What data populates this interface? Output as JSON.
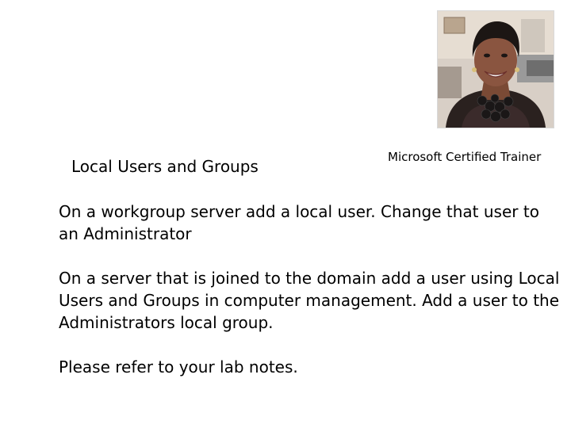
{
  "slide": {
    "title": "Local Users and Groups",
    "photo_caption": "Microsoft Certified Trainer",
    "paragraphs": [
      "On a workgroup server add a local user.  Change that user to an Administrator",
      "On a server that is joined to the domain add a user using Local Users and Groups in computer management.  Add a user to the Administrators local group.",
      "Please refer to your lab notes."
    ]
  },
  "colors": {
    "background": "#ffffff",
    "text": "#000000"
  }
}
